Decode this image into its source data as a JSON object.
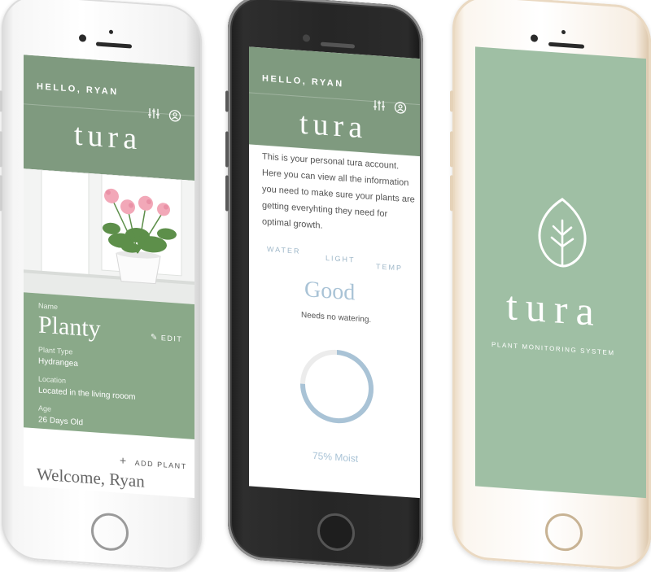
{
  "colors": {
    "sage": "#8aa989",
    "sage_dark": "#7f9a7f",
    "light_blue": "#a9c3d6",
    "ring_track": "#ececec"
  },
  "profile_screen": {
    "greeting": "HELLO, RYAN",
    "brand": "tura",
    "settings_icon": "sliders-icon",
    "account_icon": "user-icon",
    "plant_photo_icon": "geranium-photo",
    "name_label": "Name",
    "plant_name": "Planty",
    "edit_label": "EDIT",
    "type_label": "Plant Type",
    "type_value": "Hydrangea",
    "location_label": "Location",
    "location_value": "Located in the living rooom",
    "age_label": "Age",
    "age_value": "26 Days Old",
    "add_plant_label": "ADD PLANT",
    "welcome": "Welcome, Ryan"
  },
  "dashboard_screen": {
    "greeting": "HELLO, RYAN",
    "brand": "tura",
    "intro_lines": [
      "This is your personal tura account.",
      "Here you can view all the information",
      "you need to make sure your plants are",
      "getting everyhting they need for",
      "optimal growth."
    ],
    "tabs": [
      "WATER",
      "LIGHT",
      "TEMP"
    ],
    "status": "Good",
    "status_detail": "Needs no watering.",
    "moisture_fraction": 0.75,
    "moisture_label": "75% Moist"
  },
  "splash_screen": {
    "logo_icon": "leaf-icon",
    "brand": "tura",
    "tagline": "PLANT MONITORING SYSTEM"
  }
}
